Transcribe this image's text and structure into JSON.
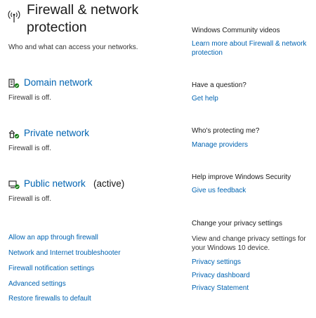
{
  "header": {
    "icon": "wifi-antenna-icon",
    "title": "Firewall & network protection",
    "subtitle": "Who and what can access your networks."
  },
  "networks": [
    {
      "name": "Domain network",
      "active_label": "",
      "status": "Firewall is off.",
      "icon": "domain-network-icon"
    },
    {
      "name": "Private network",
      "active_label": "",
      "status": "Firewall is off.",
      "icon": "private-network-icon"
    },
    {
      "name": "Public network",
      "active_label": "(active)",
      "status": "Firewall is off.",
      "icon": "public-network-icon"
    }
  ],
  "links": [
    "Allow an app through firewall",
    "Network and Internet troubleshooter",
    "Firewall notification settings",
    "Advanced settings",
    "Restore firewalls to default"
  ],
  "side": {
    "community": {
      "heading": "Windows Community videos",
      "link": "Learn more about Firewall & network protection"
    },
    "question": {
      "heading": "Have a question?",
      "link": "Get help"
    },
    "protecting": {
      "heading": "Who's protecting me?",
      "link": "Manage providers"
    },
    "improve": {
      "heading": "Help improve Windows Security",
      "link": "Give us feedback"
    },
    "privacy": {
      "heading": "Change your privacy settings",
      "text": "View and change privacy settings for your Windows 10 device.",
      "links": [
        "Privacy settings",
        "Privacy dashboard",
        "Privacy Statement"
      ]
    }
  },
  "colors": {
    "link": "#0063b1",
    "text": "#1a1a1a",
    "status_ok": "#107c10"
  }
}
